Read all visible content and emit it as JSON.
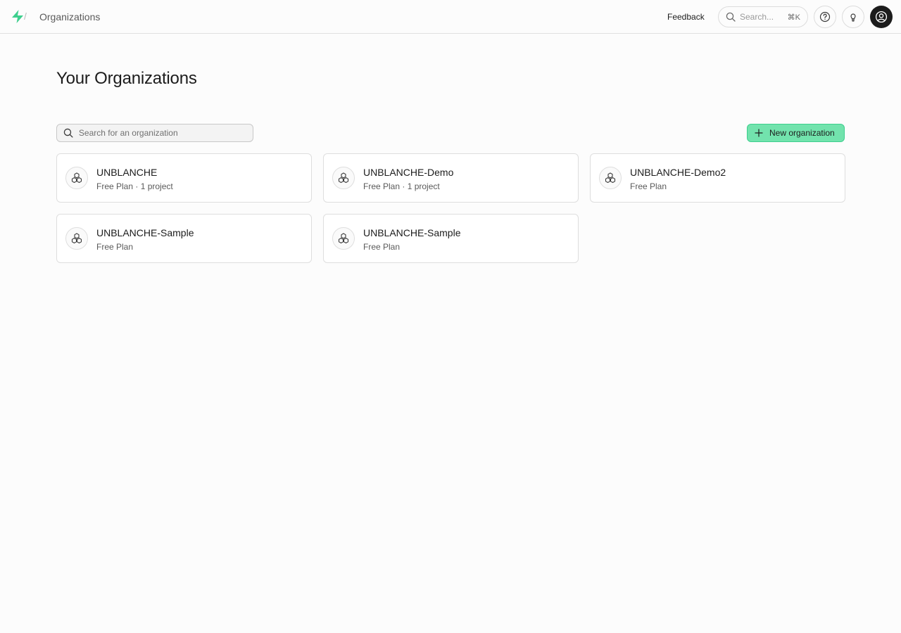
{
  "header": {
    "breadcrumb": "Organizations",
    "feedback_label": "Feedback",
    "search_placeholder": "Search...",
    "search_shortcut": "⌘K"
  },
  "page": {
    "title": "Your Organizations",
    "search_placeholder": "Search for an organization",
    "new_org_label": "New organization"
  },
  "organizations": [
    {
      "name": "UNBLANCHE",
      "meta": "Free Plan  ·  1 project"
    },
    {
      "name": "UNBLANCHE-Demo",
      "meta": "Free Plan  ·  1 project"
    },
    {
      "name": "UNBLANCHE-Demo2",
      "meta": "Free Plan"
    },
    {
      "name": "UNBLANCHE-Sample",
      "meta": "Free Plan"
    },
    {
      "name": "UNBLANCHE-Sample",
      "meta": "Free Plan"
    }
  ],
  "colors": {
    "brand": "#3ecf8e",
    "button_bg": "#72e3ad",
    "background": "#fcfcfc"
  },
  "icons": {
    "logo": "supabase-bolt-icon",
    "search": "search-icon",
    "help": "help-circle-icon",
    "tips": "lightbulb-icon",
    "avatar": "user-avatar-icon",
    "plus": "plus-icon",
    "org": "boxes-icon"
  }
}
